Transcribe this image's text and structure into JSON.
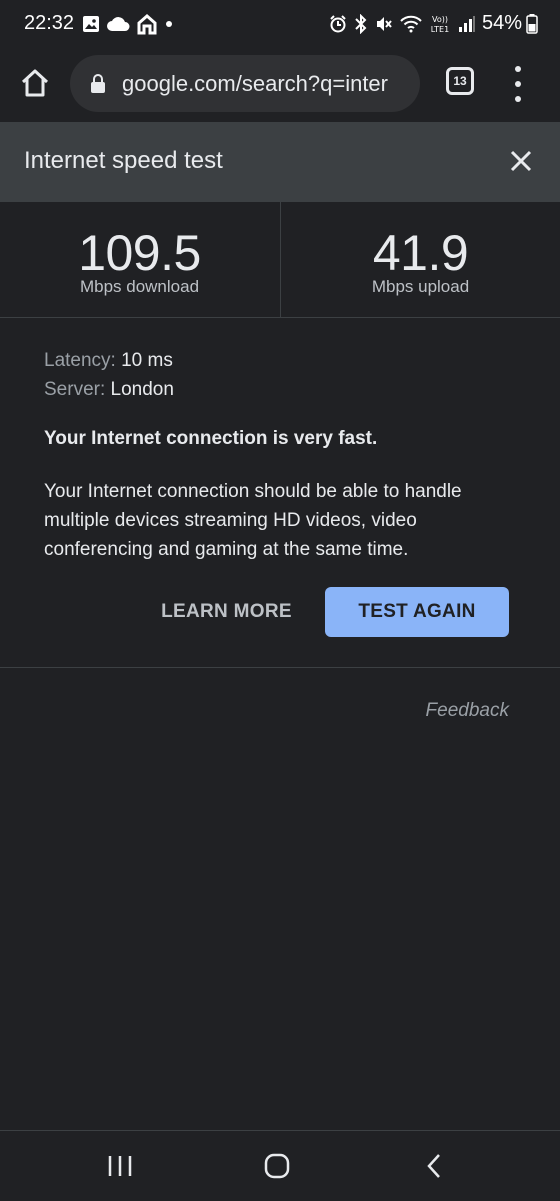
{
  "status_bar": {
    "time": "22:32",
    "battery": "54%",
    "left_icons": [
      "gallery-icon",
      "cloud-icon",
      "home-status-icon",
      "dot-icon"
    ],
    "right_icons": [
      "alarm-icon",
      "bluetooth-icon",
      "mute-icon",
      "wifi-icon",
      "volte-icon",
      "signal-icon"
    ]
  },
  "browser": {
    "url": "google.com/search?q=inter",
    "tab_count": "13"
  },
  "speed_test": {
    "title": "Internet speed test",
    "download_value": "109.5",
    "download_unit": "Mbps download",
    "upload_value": "41.9",
    "upload_unit": "Mbps upload",
    "latency_label": "Latency:",
    "latency_value": "10 ms",
    "server_label": "Server:",
    "server_value": "London",
    "summary_heading": "Your Internet connection is very fast.",
    "summary_body": "Your Internet connection should be able to handle multiple devices streaming HD videos, video conferencing and gaming at the same time.",
    "learn_more_label": "LEARN MORE",
    "test_again_label": "TEST AGAIN",
    "feedback_label": "Feedback"
  },
  "colors": {
    "background": "#202124",
    "header": "#3c4043",
    "accent": "#8ab4f8"
  }
}
